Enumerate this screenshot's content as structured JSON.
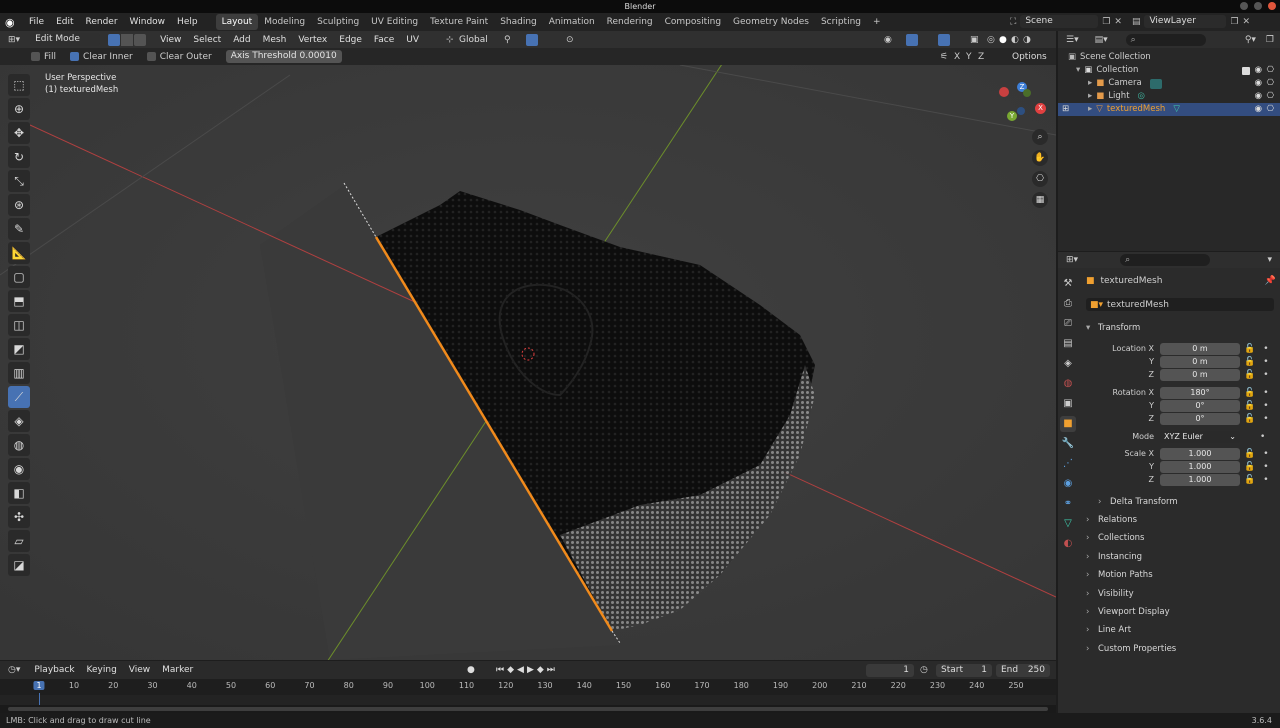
{
  "window": {
    "title": "Blender"
  },
  "menu": {
    "items": [
      "File",
      "Edit",
      "Render",
      "Window",
      "Help"
    ]
  },
  "workspaces": {
    "tabs": [
      "Layout",
      "Modeling",
      "Sculpting",
      "UV Editing",
      "Texture Paint",
      "Shading",
      "Animation",
      "Rendering",
      "Compositing",
      "Geometry Nodes",
      "Scripting"
    ],
    "active": "Layout",
    "add": "+"
  },
  "scene": {
    "name": "Scene",
    "viewlayer": "ViewLayer"
  },
  "viewport_header": {
    "mode": "Edit Mode",
    "menus": [
      "View",
      "Select",
      "Add",
      "Mesh",
      "Vertex",
      "Edge",
      "Face",
      "UV"
    ],
    "orientation": "Global",
    "options": "Options",
    "axes": [
      "X",
      "Y",
      "Z"
    ]
  },
  "tool_options": {
    "fill": "Fill",
    "clear_inner": "Clear Inner",
    "clear_outer": "Clear Outer",
    "axis_threshold_label": "Axis Threshold",
    "axis_threshold_value": "0.00010",
    "fill_checked": false,
    "clear_inner_checked": true,
    "clear_outer_checked": false
  },
  "viewport": {
    "perspective": "User Perspective",
    "object": "(1) texturedMesh"
  },
  "gizmo": {
    "x": "X",
    "y": "Y",
    "z": "Z"
  },
  "outliner": {
    "root": "Scene Collection",
    "collection": "Collection",
    "items": [
      "Camera",
      "Light",
      "texturedMesh"
    ],
    "selected": "texturedMesh"
  },
  "properties": {
    "object_name": "texturedMesh",
    "data_name": "texturedMesh",
    "transform": "Transform",
    "location_label": "Location X",
    "location": [
      "0 m",
      "0 m",
      "0 m"
    ],
    "rotation_label": "Rotation X",
    "rotation": [
      "180°",
      "0°",
      "0°"
    ],
    "mode_label": "Mode",
    "mode": "XYZ Euler",
    "scale_label": "Scale X",
    "scale": [
      "1.000",
      "1.000",
      "1.000"
    ],
    "y": "Y",
    "z": "Z",
    "panels": [
      "Delta Transform",
      "Relations",
      "Collections",
      "Instancing",
      "Motion Paths",
      "Visibility",
      "Viewport Display",
      "Line Art",
      "Custom Properties"
    ]
  },
  "timeline": {
    "menus": [
      "Playback",
      "Keying",
      "View",
      "Marker"
    ],
    "current": "1",
    "start_label": "Start",
    "start": "1",
    "end_label": "End",
    "end": "250",
    "ticks": [
      "1",
      "10",
      "20",
      "30",
      "40",
      "50",
      "60",
      "70",
      "80",
      "90",
      "100",
      "110",
      "120",
      "130",
      "140",
      "150",
      "160",
      "170",
      "180",
      "190",
      "200",
      "210",
      "220",
      "230",
      "240",
      "250"
    ]
  },
  "status": {
    "hint": "LMB: Click and drag to draw cut line",
    "version": "3.6.4"
  }
}
